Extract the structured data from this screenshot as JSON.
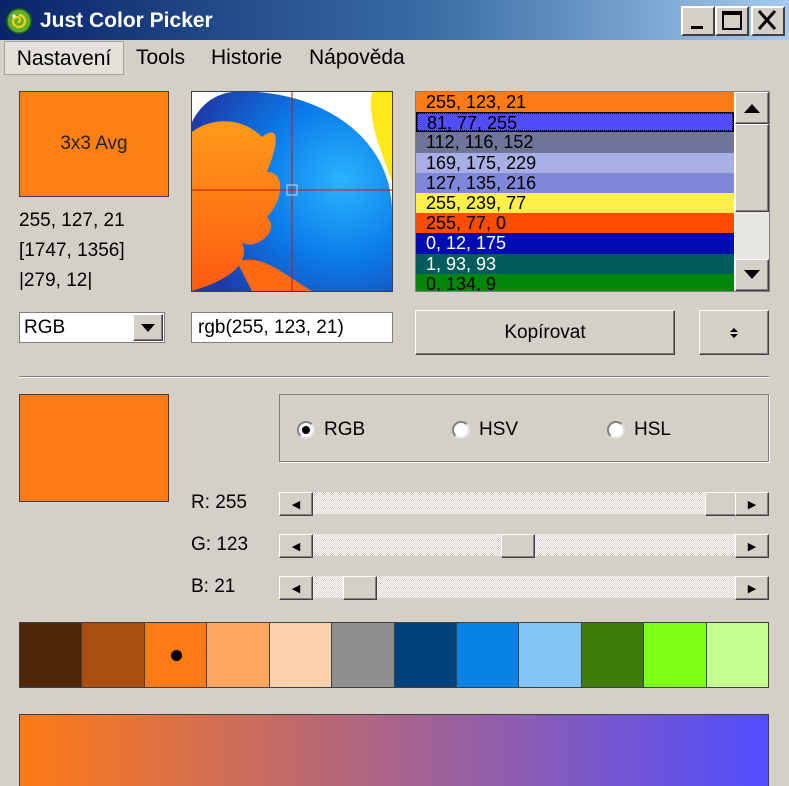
{
  "window": {
    "title": "Just Color Picker"
  },
  "menu": [
    "Nastavení",
    "Tools",
    "Historie",
    "Nápověda"
  ],
  "sample": {
    "mode_label": "3x3 Avg",
    "color": "#ff7f15",
    "rgb": "255, 127, 21",
    "screen_pos": "[1747, 1356]",
    "relative_pos": "|279, 12|"
  },
  "history": [
    {
      "text": "255, 123, 21",
      "bg": "#ff7b15",
      "fg": "#000000"
    },
    {
      "text": "81, 77, 255",
      "bg": "#514dff",
      "fg": "#000000",
      "selected": true
    },
    {
      "text": "112, 116, 152",
      "bg": "#707498",
      "fg": "#000000"
    },
    {
      "text": "169, 175, 229",
      "bg": "#a9afe5",
      "fg": "#000000"
    },
    {
      "text": "127, 135, 216",
      "bg": "#7f87d8",
      "fg": "#000000"
    },
    {
      "text": "255, 239, 77",
      "bg": "#ffef4d",
      "fg": "#000000"
    },
    {
      "text": "255, 77, 0",
      "bg": "#ff4d00",
      "fg": "#000000"
    },
    {
      "text": "0, 12, 175",
      "bg": "#000caf",
      "fg": "#ffffff"
    },
    {
      "text": "1, 93, 93",
      "bg": "#015d5d",
      "fg": "#ffffff"
    },
    {
      "text": "0, 134, 9",
      "bg": "#008609",
      "fg": "#000000"
    }
  ],
  "format": {
    "selected": "RGB",
    "value": "rgb(255, 123, 21)",
    "copy_label": "Kopírovat"
  },
  "current_color": "#ff7b15",
  "modes": {
    "options": [
      "RGB",
      "HSV",
      "HSL"
    ],
    "selected": "RGB"
  },
  "sliders": [
    {
      "label": "R: 255",
      "value": 255,
      "max": 255
    },
    {
      "label": "G: 123",
      "value": 123,
      "max": 255
    },
    {
      "label": "B: 21",
      "value": 21,
      "max": 255
    }
  ],
  "palette": [
    {
      "color": "#4f2707"
    },
    {
      "color": "#a94f10"
    },
    {
      "color": "#ff7b15",
      "selected": true
    },
    {
      "color": "#ffa660"
    },
    {
      "color": "#ffd0ae"
    },
    {
      "color": "#8f8f8f"
    },
    {
      "color": "#00427a"
    },
    {
      "color": "#0582e6"
    },
    {
      "color": "#82c4f5"
    },
    {
      "color": "#3e7d0a"
    },
    {
      "color": "#7dff18"
    },
    {
      "color": "#c3ff8f"
    }
  ],
  "gradient": {
    "from": "#ff7b15",
    "to": "#514dff"
  }
}
